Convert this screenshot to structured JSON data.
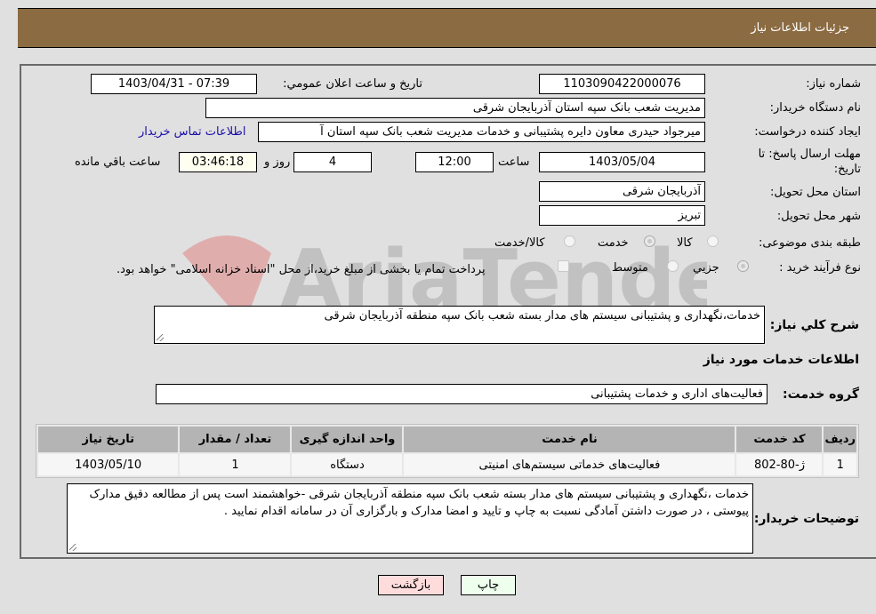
{
  "header": {
    "title": "جزئیات اطلاعات نیاز"
  },
  "fields": {
    "need_number_label": "شماره نیاز:",
    "need_number": "1103090422000076",
    "announce_label": "تاریخ و ساعت اعلان عمومي:",
    "announce_value": "1403/04/31 - 07:39",
    "buyer_org_label": "نام دستگاه خریدار:",
    "buyer_org": "مدیریت شعب بانک سپه استان آذربایجان شرقی",
    "creator_label": "ایجاد کننده درخواست:",
    "creator": "میرجواد حیدری معاون دایره پشتیبانی و خدمات مدیریت شعب بانک سپه استان آ",
    "contact_link": "اطلاعات تماس خریدار",
    "deadline_label_1": "مهلت ارسال پاسخ: تا",
    "deadline_label_2": "تاریخ:",
    "deadline_date": "1403/05/04",
    "time_label": "ساعت",
    "deadline_time": "12:00",
    "days_value": "4",
    "days_label": "روز و",
    "remaining_time": "03:46:18",
    "remaining_label": "ساعت باقي مانده",
    "province_label": "استان محل تحویل:",
    "province": "آذربایجان شرقی",
    "city_label": "شهر محل تحویل:",
    "city": "تبریز",
    "category_label": "طبقه بندی موضوعی:",
    "category_options": [
      {
        "label": "کالا",
        "checked": false
      },
      {
        "label": "خدمت",
        "checked": true
      },
      {
        "label": "کالا/خدمت",
        "checked": false
      }
    ],
    "purchase_type_label": "نوع فرآیند خرید :",
    "purchase_options": [
      {
        "label": "جزيي",
        "checked": true
      },
      {
        "label": "متوسط",
        "checked": false
      }
    ],
    "treasury_note": "پرداخت تمام یا بخشی از مبلغ خرید،از محل \"اسناد خزانه اسلامی\" خواهد بود."
  },
  "summary": {
    "label": "شرح کلي نیاز:",
    "value": "خدمات،نگهداری و پشتیبانی سیستم های مدار بسته شعب بانک سپه منطقه آذربایجان شرقی"
  },
  "services_section": {
    "title": "اطلاعات خدمات مورد نیاز",
    "group_label": "گروه خدمت:",
    "group_value": "فعالیت‌های اداری و خدمات پشتیبانی"
  },
  "table": {
    "headers": [
      "ردیف",
      "کد خدمت",
      "نام خدمت",
      "واحد اندازه گیری",
      "تعداد / مقدار",
      "تاریخ نیاز"
    ],
    "rows": [
      [
        "1",
        "ژ-80-802",
        "فعالیت‌های خدماتی سیستم‌های امنیتی",
        "دستگاه",
        "1",
        "1403/05/10"
      ]
    ]
  },
  "buyer_notes": {
    "label": "توضیحات خریدار:",
    "value": "خدمات ،نگهداری و پشتیبانی سیستم های مدار بسته شعب بانک سپه منطقه آذربایجان شرقی -خواهشمند است پس از مطالعه دقیق مدارک پیوستی ، در صورت داشتن آمادگی نسبت به چاپ و تایید و امضا مدارک و بارگزاری آن در سامانه اقدام نمایید ."
  },
  "buttons": {
    "print": "چاپ",
    "back": "بازگشت"
  },
  "colors": {
    "header_bg": "#8b6b42",
    "print_bg": "#eeffee",
    "back_bg": "#ffdcdc"
  },
  "watermark": "AriaTender.neT"
}
